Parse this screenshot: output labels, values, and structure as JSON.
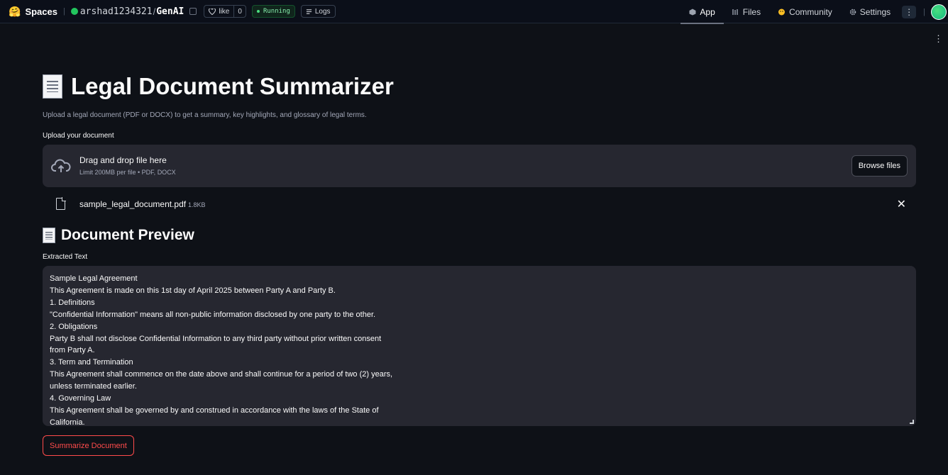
{
  "topbar": {
    "logo_glyph": "🤗",
    "brand": "Spaces",
    "owner": "arshad1234321",
    "separator": "/",
    "repo": "GenAI",
    "like_label": "like",
    "like_count": "0",
    "status": "Running",
    "logs_label": "Logs",
    "tabs": [
      {
        "label": "App",
        "icon": "cube-icon",
        "active": true
      },
      {
        "label": "Files",
        "icon": "files-icon",
        "active": false
      },
      {
        "label": "Community",
        "icon": "community-icon",
        "active": false
      },
      {
        "label": "Settings",
        "icon": "gear-icon",
        "active": false
      }
    ],
    "menu_glyph": "⋮"
  },
  "app_menu_glyph": "⋮",
  "main": {
    "title": "Legal Document Summarizer",
    "subtitle": "Upload a legal document (PDF or DOCX) to get a summary, key highlights, and glossary of legal terms.",
    "upload_label": "Upload your document",
    "uploader": {
      "primary": "Drag and drop file here",
      "secondary": "Limit 200MB per file • PDF, DOCX",
      "browse_label": "Browse files"
    },
    "file": {
      "name": "sample_legal_document.pdf",
      "size": "1.8KB",
      "remove_glyph": "✕"
    },
    "preview_heading": "Document Preview",
    "extracted_label": "Extracted Text",
    "extracted_lines": [
      "Sample Legal Agreement",
      "This Agreement is made on this 1st day of April 2025 between Party A and Party B.",
      "1. Definitions",
      "\"Confidential Information\" means all non-public information disclosed by one party to the other.",
      "2. Obligations",
      "Party B shall not disclose Confidential Information to any third party without prior written consent",
      "from Party A.",
      "3. Term and Termination",
      "This Agreement shall commence on the date above and shall continue for a period of two (2) years,",
      "unless terminated earlier.",
      "4. Governing Law",
      "This Agreement shall be governed by and construed in accordance with the laws of the State of",
      "California."
    ],
    "summarize_label": "Summarize Document"
  },
  "colors": {
    "background": "#0e1117",
    "panel": "#262730",
    "accent": "#ff4b4b",
    "status_green": "#22c55e"
  }
}
